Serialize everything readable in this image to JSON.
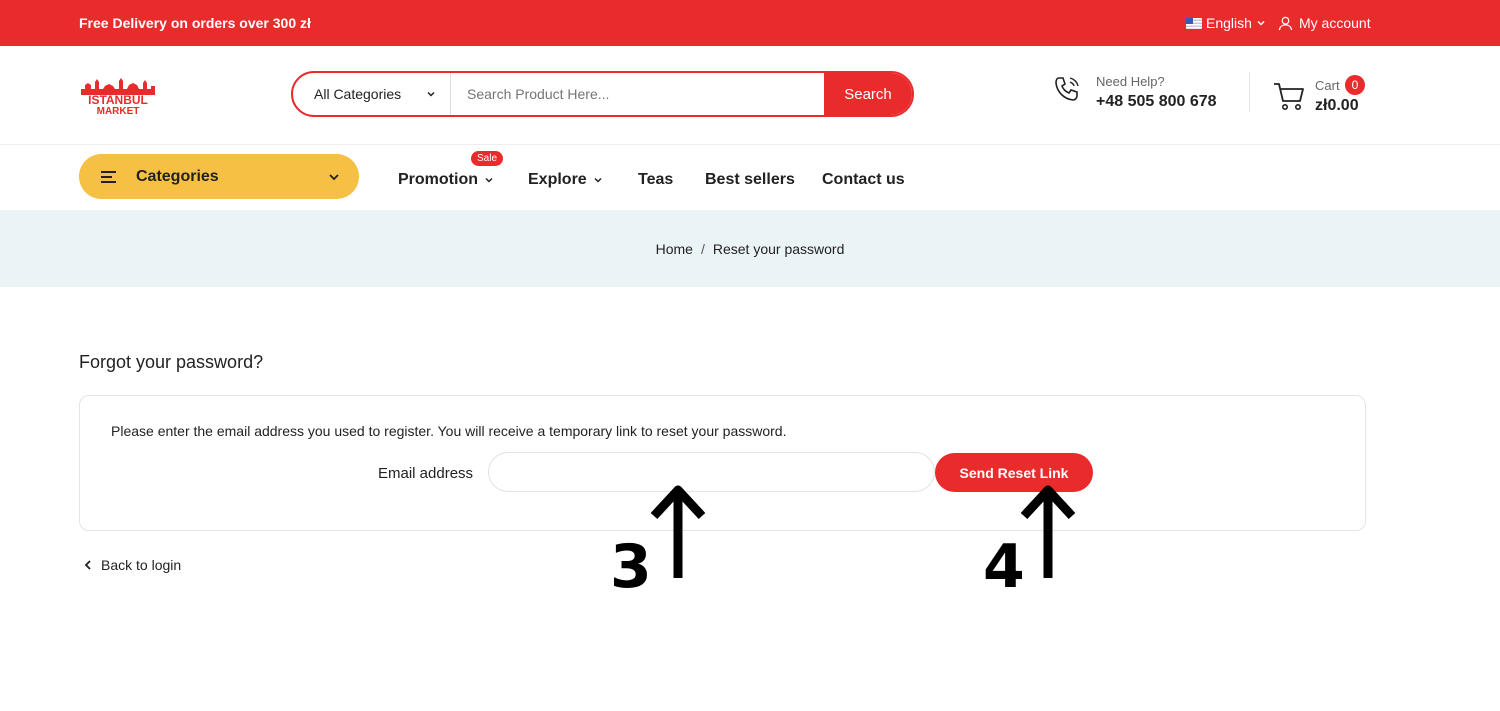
{
  "topbar": {
    "promo": "Free Delivery on orders over 300 zł",
    "language": "English",
    "account": "My account"
  },
  "header": {
    "logo_text_top": "ISTANBUL",
    "logo_text_bottom": "MARKET",
    "search": {
      "category": "All Categories",
      "placeholder": "Search Product Here...",
      "button": "Search"
    },
    "help_label": "Need Help?",
    "phone": "+48 505 800 678",
    "cart_label": "Cart",
    "cart_count": "0",
    "cart_total": "zł0.00"
  },
  "nav": {
    "categories": "Categories",
    "items": [
      {
        "label": "Promotion"
      },
      {
        "label": "Explore"
      },
      {
        "label": "Teas"
      },
      {
        "label": "Best sellers"
      },
      {
        "label": "Contact us"
      }
    ],
    "sale_badge": "Sale"
  },
  "breadcrumb": {
    "home": "Home",
    "separator": "/",
    "current": "Reset your password"
  },
  "form": {
    "title": "Forgot your password?",
    "description": "Please enter the email address you used to register. You will receive a temporary link to reset your password.",
    "email_label": "Email address",
    "email_value": "",
    "submit": "Send Reset Link",
    "back": "Back to login"
  },
  "annotations": [
    "3",
    "4"
  ],
  "colors": {
    "brand_red": "#ea2b2b",
    "categories_yellow": "#f5c043",
    "breadcrumb_bg": "#eaf3f5"
  }
}
